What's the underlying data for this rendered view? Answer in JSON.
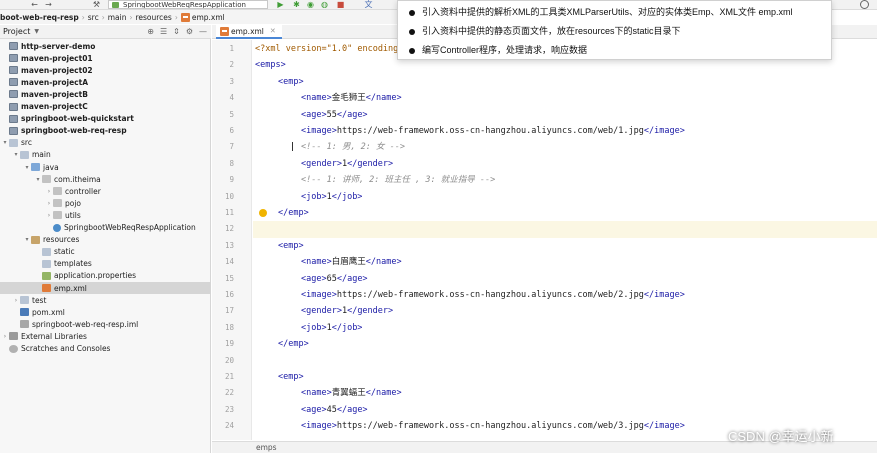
{
  "toolbar": {
    "run_config": "SpringbootWebReqRespApplication"
  },
  "breadcrumb": [
    "boot-web-req-resp",
    "src",
    "main",
    "resources",
    "emp.xml"
  ],
  "project_panel": {
    "title": "Project",
    "tree": [
      {
        "label": "http-server-demo",
        "depth": 0,
        "icon": "module-icon",
        "bold": true,
        "chevron": ""
      },
      {
        "label": "maven-project01",
        "depth": 0,
        "icon": "module-icon",
        "bold": true,
        "chevron": ""
      },
      {
        "label": "maven-project02",
        "depth": 0,
        "icon": "module-icon",
        "bold": true,
        "chevron": ""
      },
      {
        "label": "maven-projectA",
        "depth": 0,
        "icon": "module-icon",
        "bold": true,
        "chevron": ""
      },
      {
        "label": "maven-projectB",
        "depth": 0,
        "icon": "module-icon",
        "bold": true,
        "chevron": ""
      },
      {
        "label": "maven-projectC",
        "depth": 0,
        "icon": "module-icon",
        "bold": true,
        "chevron": ""
      },
      {
        "label": "springboot-web-quickstart",
        "depth": 0,
        "icon": "module-icon",
        "bold": true,
        "chevron": ""
      },
      {
        "label": "springboot-web-req-resp",
        "depth": 0,
        "icon": "module-icon",
        "bold": true,
        "chevron": ""
      },
      {
        "label": "src",
        "depth": 0,
        "icon": "folder-icon",
        "bold": false,
        "chevron": "▾"
      },
      {
        "label": "main",
        "depth": 1,
        "icon": "folder-icon",
        "bold": false,
        "chevron": "▾"
      },
      {
        "label": "java",
        "depth": 2,
        "icon": "source-folder-icon",
        "bold": false,
        "chevron": "▾"
      },
      {
        "label": "com.itheima",
        "depth": 3,
        "icon": "package-icon",
        "bold": false,
        "chevron": "▾"
      },
      {
        "label": "controller",
        "depth": 4,
        "icon": "package-icon",
        "bold": false,
        "chevron": "›"
      },
      {
        "label": "pojo",
        "depth": 4,
        "icon": "package-icon",
        "bold": false,
        "chevron": "›"
      },
      {
        "label": "utils",
        "depth": 4,
        "icon": "package-icon",
        "bold": false,
        "chevron": "›"
      },
      {
        "label": "SpringbootWebReqRespApplication",
        "depth": 4,
        "icon": "class-icon",
        "bold": false,
        "chevron": ""
      },
      {
        "label": "resources",
        "depth": 2,
        "icon": "resources-folder-icon",
        "bold": false,
        "chevron": "▾"
      },
      {
        "label": "static",
        "depth": 3,
        "icon": "folder-icon",
        "bold": false,
        "chevron": ""
      },
      {
        "label": "templates",
        "depth": 3,
        "icon": "folder-icon",
        "bold": false,
        "chevron": ""
      },
      {
        "label": "application.properties",
        "depth": 3,
        "icon": "properties-file-icon",
        "bold": false,
        "chevron": ""
      },
      {
        "label": "emp.xml",
        "depth": 3,
        "icon": "xml-file-icon",
        "bold": false,
        "chevron": "",
        "selected": true
      },
      {
        "label": "test",
        "depth": 1,
        "icon": "folder-icon",
        "bold": false,
        "chevron": "›"
      },
      {
        "label": "pom.xml",
        "depth": 1,
        "icon": "pom-file-icon",
        "bold": false,
        "chevron": ""
      },
      {
        "label": "springboot-web-req-resp.iml",
        "depth": 1,
        "icon": "iml-file-icon",
        "bold": false,
        "chevron": ""
      },
      {
        "label": "External Libraries",
        "depth": 0,
        "icon": "library-icon",
        "bold": false,
        "chevron": "›"
      },
      {
        "label": "Scratches and Consoles",
        "depth": 0,
        "icon": "scratch-icon",
        "bold": false,
        "chevron": ""
      }
    ]
  },
  "editor": {
    "tab_label": "emp.xml",
    "status_crumb": "emps",
    "caret_line": 7,
    "intention_bulb_line": 11,
    "lines": [
      {
        "n": "1",
        "indent": 0,
        "parts": [
          {
            "t": "<?xml version=\"1.0\" encoding=\"UTF-8\" ?>",
            "c": "decl"
          }
        ]
      },
      {
        "n": "2",
        "indent": 0,
        "parts": [
          {
            "t": "<emps>",
            "c": "tag"
          }
        ]
      },
      {
        "n": "3",
        "indent": 1,
        "parts": [
          {
            "t": "<emp>",
            "c": "tag"
          }
        ]
      },
      {
        "n": "4",
        "indent": 2,
        "parts": [
          {
            "t": "<name>",
            "c": "tag"
          },
          {
            "t": "金毛狮王",
            "c": "txt"
          },
          {
            "t": "</name>",
            "c": "tag"
          }
        ]
      },
      {
        "n": "5",
        "indent": 2,
        "parts": [
          {
            "t": "<age>",
            "c": "tag"
          },
          {
            "t": "55",
            "c": "txt"
          },
          {
            "t": "</age>",
            "c": "tag"
          }
        ]
      },
      {
        "n": "6",
        "indent": 2,
        "parts": [
          {
            "t": "<image>",
            "c": "tag"
          },
          {
            "t": "https://web-framework.oss-cn-hangzhou.aliyuncs.com/web/1.jpg",
            "c": "txt"
          },
          {
            "t": "</image>",
            "c": "tag"
          }
        ]
      },
      {
        "n": "7",
        "indent": 2,
        "parts": [
          {
            "t": "<!-- 1: 男, 2: 女 -->",
            "c": "cmt"
          }
        ]
      },
      {
        "n": "8",
        "indent": 2,
        "parts": [
          {
            "t": "<gender>",
            "c": "tag"
          },
          {
            "t": "1",
            "c": "txt"
          },
          {
            "t": "</gender>",
            "c": "tag"
          }
        ]
      },
      {
        "n": "9",
        "indent": 2,
        "parts": [
          {
            "t": "<!-- 1: 讲师, 2: 班主任 , 3: 就业指导 -->",
            "c": "cmt"
          }
        ]
      },
      {
        "n": "10",
        "indent": 2,
        "parts": [
          {
            "t": "<job>",
            "c": "tag"
          },
          {
            "t": "1",
            "c": "txt"
          },
          {
            "t": "</job>",
            "c": "tag"
          }
        ]
      },
      {
        "n": "11",
        "indent": 1,
        "parts": [
          {
            "t": "</emp>",
            "c": "tag"
          }
        ]
      },
      {
        "n": "12",
        "indent": 0,
        "parts": [],
        "highlight": true
      },
      {
        "n": "13",
        "indent": 1,
        "parts": [
          {
            "t": "<emp>",
            "c": "tag"
          }
        ]
      },
      {
        "n": "14",
        "indent": 2,
        "parts": [
          {
            "t": "<name>",
            "c": "tag"
          },
          {
            "t": "白眉鹰王",
            "c": "txt"
          },
          {
            "t": "</name>",
            "c": "tag"
          }
        ]
      },
      {
        "n": "15",
        "indent": 2,
        "parts": [
          {
            "t": "<age>",
            "c": "tag"
          },
          {
            "t": "65",
            "c": "txt"
          },
          {
            "t": "</age>",
            "c": "tag"
          }
        ]
      },
      {
        "n": "16",
        "indent": 2,
        "parts": [
          {
            "t": "<image>",
            "c": "tag"
          },
          {
            "t": "https://web-framework.oss-cn-hangzhou.aliyuncs.com/web/2.jpg",
            "c": "txt"
          },
          {
            "t": "</image>",
            "c": "tag"
          }
        ]
      },
      {
        "n": "17",
        "indent": 2,
        "parts": [
          {
            "t": "<gender>",
            "c": "tag"
          },
          {
            "t": "1",
            "c": "txt"
          },
          {
            "t": "</gender>",
            "c": "tag"
          }
        ]
      },
      {
        "n": "18",
        "indent": 2,
        "parts": [
          {
            "t": "<job>",
            "c": "tag"
          },
          {
            "t": "1",
            "c": "txt"
          },
          {
            "t": "</job>",
            "c": "tag"
          }
        ]
      },
      {
        "n": "19",
        "indent": 1,
        "parts": [
          {
            "t": "</emp>",
            "c": "tag"
          }
        ]
      },
      {
        "n": "20",
        "indent": 0,
        "parts": []
      },
      {
        "n": "21",
        "indent": 1,
        "parts": [
          {
            "t": "<emp>",
            "c": "tag"
          }
        ]
      },
      {
        "n": "22",
        "indent": 2,
        "parts": [
          {
            "t": "<name>",
            "c": "tag"
          },
          {
            "t": "青翼蝠王",
            "c": "txt"
          },
          {
            "t": "</name>",
            "c": "tag"
          }
        ]
      },
      {
        "n": "23",
        "indent": 2,
        "parts": [
          {
            "t": "<age>",
            "c": "tag"
          },
          {
            "t": "45",
            "c": "txt"
          },
          {
            "t": "</age>",
            "c": "tag"
          }
        ]
      },
      {
        "n": "24",
        "indent": 2,
        "parts": [
          {
            "t": "<image>",
            "c": "tag"
          },
          {
            "t": "https://web-framework.oss-cn-hangzhou.aliyuncs.com/web/3.jpg",
            "c": "txt"
          },
          {
            "t": "</image>",
            "c": "tag"
          }
        ]
      }
    ]
  },
  "overlay_note": {
    "items": [
      "引入资料中提供的解析XML的工具类XMLParserUtils、对应的实体类Emp、XML文件 emp.xml",
      "引入资料中提供的静态页面文件，放在resources下的static目录下",
      "编写Controller程序，处理请求，响应数据"
    ]
  },
  "watermark": "CSDN @幸运小新"
}
